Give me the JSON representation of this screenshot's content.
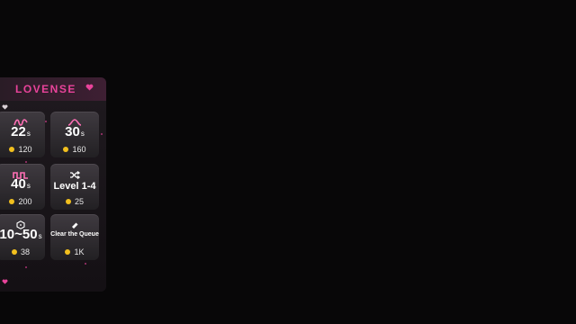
{
  "brand": {
    "logo_text": "LOVENSE",
    "accent": "#e8439a",
    "coin_color": "#f2c01e"
  },
  "tiles": [
    {
      "icon": "wave-pattern-icon",
      "value": "22",
      "unit": "s",
      "price": "120"
    },
    {
      "icon": "curve-pattern-icon",
      "value": "30",
      "unit": "s",
      "price": "160"
    },
    {
      "icon": "pulse-pattern-icon",
      "value": "40",
      "unit": "s",
      "price": "200"
    },
    {
      "icon": "shuffle-icon",
      "value": "Level 1-4",
      "unit": "",
      "price": "25"
    },
    {
      "icon": "dice-icon",
      "value": "10~50",
      "unit": "s",
      "price": "38"
    },
    {
      "icon": "eraser-icon",
      "value": "Clear the Queue",
      "unit": "",
      "price": "1K"
    }
  ]
}
